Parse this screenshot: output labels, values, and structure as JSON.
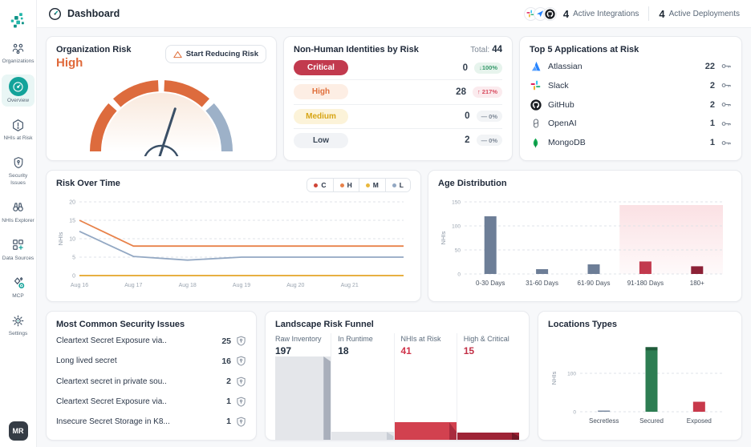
{
  "colors": {
    "accent_teal": "#14a39a",
    "risk_orange": "#e0703c",
    "risk_critical": "#c23a4e",
    "risk_medium": "#d7a515",
    "risk_low_slate": "#93a8c3",
    "secured_green": "#2d7d52"
  },
  "header": {
    "title": "Dashboard",
    "integrations": {
      "count": "4",
      "label": "Active Integrations",
      "icons": [
        "slack-icon",
        "jira-icon",
        "github-icon"
      ]
    },
    "deployments": {
      "count": "4",
      "label": "Active Deployments"
    }
  },
  "sidebar": {
    "items": [
      {
        "label": "Organizations",
        "icon": "organizations",
        "active": false
      },
      {
        "label": "Overview",
        "icon": "overview",
        "active": true
      },
      {
        "label": "NHIs at Risk",
        "icon": "nhis-at-risk",
        "active": false
      },
      {
        "label": "Security Issues",
        "icon": "security-issues",
        "active": false
      },
      {
        "label": "NHIs Explorer",
        "icon": "nhis-explorer",
        "active": false
      },
      {
        "label": "Data Sources",
        "icon": "data-sources",
        "active": false
      },
      {
        "label": "MCP",
        "icon": "mcp",
        "active": false
      },
      {
        "label": "Settings",
        "icon": "settings",
        "active": false
      }
    ],
    "avatar": "MR"
  },
  "org_risk": {
    "title": "Organization Risk",
    "level": "High",
    "button_label": "Start Reducing Risk"
  },
  "nhi": {
    "title": "Non-Human Identities by Risk",
    "total_label": "Total:",
    "total": "44",
    "rows": [
      {
        "label": "Critical",
        "tone": "critical",
        "value": "0",
        "trend": "↓100%",
        "trend_tone": "good"
      },
      {
        "label": "High",
        "tone": "high",
        "value": "28",
        "trend": "↑ 217%",
        "trend_tone": "bad"
      },
      {
        "label": "Medium",
        "tone": "medium",
        "value": "0",
        "trend": "— 0%",
        "trend_tone": "flat"
      },
      {
        "label": "Low",
        "tone": "low",
        "value": "2",
        "trend": "— 0%",
        "trend_tone": "flat"
      }
    ]
  },
  "top_apps": {
    "title": "Top 5 Applications at Risk",
    "rows": [
      {
        "name": "Atlassian",
        "logo": "atlassian",
        "count": "22"
      },
      {
        "name": "Slack",
        "logo": "slack",
        "count": "2"
      },
      {
        "name": "GitHub",
        "logo": "github",
        "count": "2"
      },
      {
        "name": "OpenAI",
        "logo": "openai",
        "count": "1"
      },
      {
        "name": "MongoDB",
        "logo": "mongodb",
        "count": "1"
      }
    ]
  },
  "issues": {
    "title": "Most Common Security Issues",
    "rows": [
      {
        "label": "Cleartext Secret Exposure via..",
        "count": "25"
      },
      {
        "label": "Long lived secret",
        "count": "16"
      },
      {
        "label": "Cleartext secret in private sou..",
        "count": "2"
      },
      {
        "label": "Cleartext Secret Exposure via..",
        "count": "1"
      },
      {
        "label": "Insecure Secret Storage in K8...",
        "count": "1"
      }
    ]
  },
  "chart_data": [
    {
      "id": "org_risk_gauge",
      "type": "gauge",
      "title": "Organization Risk",
      "value_label": "High",
      "segments": [
        {
          "color": "#dd6b3d"
        },
        {
          "color": "#dd6b3d"
        },
        {
          "color": "#dd6b3d"
        },
        {
          "color": "#9db1c8"
        }
      ],
      "needle_angle_deg": 72
    },
    {
      "id": "risk_over_time",
      "type": "line",
      "title": "Risk Over Time",
      "ylabel": "NHIs",
      "ylim": [
        0,
        20
      ],
      "yticks": [
        0,
        5,
        10,
        15,
        20
      ],
      "x": [
        "Aug 16",
        "Aug 17",
        "Aug 18",
        "Aug 19",
        "Aug 20",
        "Aug 21"
      ],
      "series": [
        {
          "name": "C",
          "color": "#cf4436",
          "values": [
            0,
            0,
            0,
            0,
            0,
            0,
            0
          ]
        },
        {
          "name": "H",
          "color": "#e8824a",
          "values": [
            15,
            8,
            8,
            8,
            8,
            8,
            8
          ]
        },
        {
          "name": "L",
          "color": "#93a8c3",
          "values": [
            12,
            5.2,
            4.2,
            5,
            5,
            5,
            5
          ]
        },
        {
          "name": "M",
          "color": "#e9b83d",
          "values": [
            0,
            0,
            0,
            0,
            0,
            0,
            0
          ]
        }
      ],
      "legend": [
        {
          "label": "C",
          "color": "#cf4436"
        },
        {
          "label": "H",
          "color": "#e8824a"
        },
        {
          "label": "M",
          "color": "#e9b83d"
        },
        {
          "label": "L",
          "color": "#93a8c3"
        }
      ],
      "legend_position": "top-right",
      "grid": true
    },
    {
      "id": "age_distribution",
      "type": "bar",
      "title": "Age Distribution",
      "ylabel": "NHIs",
      "ylim": [
        0,
        150
      ],
      "yticks": [
        0,
        50,
        100,
        150
      ],
      "categories": [
        "0-30 Days",
        "31-60 Days",
        "61-90 Days",
        "91-180 Days",
        "180+"
      ],
      "values": [
        120,
        10,
        20,
        26,
        16
      ],
      "colors": [
        "#6d7e97",
        "#6d7e97",
        "#6d7e97",
        "#c23a4e",
        "#8c2136"
      ],
      "highlight_region": {
        "from_category_index": 3,
        "color": "#e74c5e"
      },
      "grid": true
    },
    {
      "id": "locations_types",
      "type": "bar",
      "title": "Locations Types",
      "ylabel": "NHIs",
      "ylim": [
        0,
        175
      ],
      "yticks": [
        0,
        100
      ],
      "categories": [
        "Secretless",
        "Secured",
        "Exposed"
      ],
      "values": [
        1,
        168,
        26
      ],
      "colors": [
        "#7a8aa0",
        "#2d7d52",
        "#c8394b"
      ],
      "cap_colors": [
        null,
        "#1f5b3a",
        null
      ],
      "grid": true
    },
    {
      "id": "landscape_funnel",
      "type": "funnel",
      "title": "Landscape Risk Funnel",
      "stages": [
        {
          "label": "Raw Inventory",
          "value": 197,
          "color": "#e4e6ea",
          "edge": "#a9afbb",
          "value_color": "#222f3f"
        },
        {
          "label": "In Runtime",
          "value": 18,
          "color": "#e4e6ea",
          "edge": "#c9ced6",
          "value_color": "#222f3f"
        },
        {
          "label": "NHIs at Risk",
          "value": 41,
          "color": "#d2414f",
          "edge": "#a82c3e",
          "value_color": "#d0344b"
        },
        {
          "label": "High & Critical",
          "value": 15,
          "color": "#9e2436",
          "edge": "#731826",
          "value_color": "#c23046"
        }
      ]
    }
  ]
}
